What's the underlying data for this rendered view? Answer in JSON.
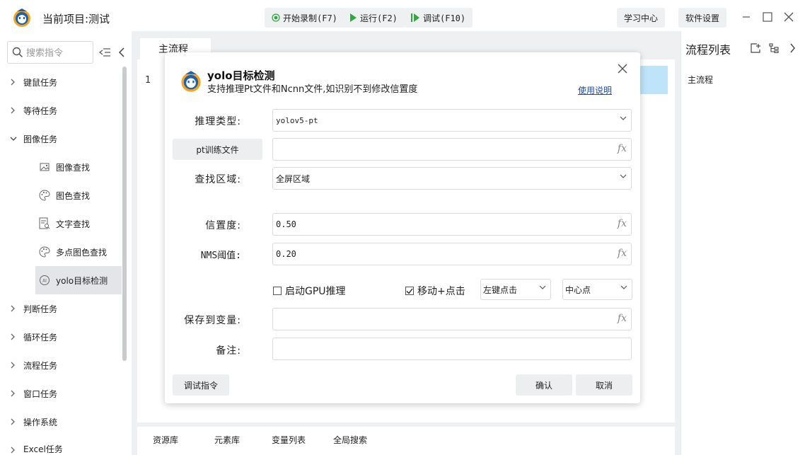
{
  "titlebar": {
    "project_title": "当前项目:测试",
    "record_label": "开始录制(F7)",
    "run_label": "运行(F2)",
    "debug_label": "调试(F10)",
    "learn_label": "学习中心",
    "settings_label": "软件设置",
    "colors": {
      "run_icon": "#2eaa3c",
      "debug_icon": "#2eaa3c",
      "record_icon": "#2eaa3c"
    }
  },
  "sidebar": {
    "search_placeholder": "搜索指令",
    "categories": [
      {
        "label": "键鼠任务",
        "expanded": false
      },
      {
        "label": "等待任务",
        "expanded": false
      },
      {
        "label": "图像任务",
        "expanded": true
      },
      {
        "label": "判断任务",
        "expanded": false
      },
      {
        "label": "循环任务",
        "expanded": false
      },
      {
        "label": "流程任务",
        "expanded": false
      },
      {
        "label": "窗口任务",
        "expanded": false
      },
      {
        "label": "操作系统",
        "expanded": false
      },
      {
        "label": "Excel任务",
        "expanded": false
      }
    ],
    "image_subitems": [
      {
        "label": "图像查找",
        "icon": "image-icon"
      },
      {
        "label": "图色查找",
        "icon": "palette-icon"
      },
      {
        "label": "文字查找",
        "icon": "text-search-icon"
      },
      {
        "label": "多点图色查找",
        "icon": "palette-icon"
      },
      {
        "label": "yolo目标检测",
        "icon": "ai-icon",
        "active": true
      }
    ]
  },
  "main": {
    "tab_label": "主流程",
    "line_number": "1",
    "bottom_tabs": [
      "资源库",
      "元素库",
      "变量列表",
      "全局搜索"
    ]
  },
  "right_panel": {
    "title": "流程列表",
    "items": [
      "主流程"
    ]
  },
  "dialog": {
    "title": "yolo目标检测",
    "subtitle": "支持推理Pt文件和Ncnn文件,如识别不到修改信置度",
    "help_link": "使用说明",
    "infer_type_label": "推理类型:",
    "infer_type_value": "yolov5-pt",
    "pt_button_label": "pt训练文件",
    "pt_file_value": "",
    "region_label": "查找区域:",
    "region_value": "全屏区域",
    "confidence_label": "信置度:",
    "confidence_value": "0.50",
    "nms_label": "NMS阈值:",
    "nms_value": "0.20",
    "gpu_label": "启动GPU推理",
    "gpu_checked": false,
    "move_click_label": "移动+点击",
    "move_click_checked": true,
    "click_type_value": "左键点击",
    "click_pos_value": "中心点",
    "save_var_label": "保存到变量:",
    "save_var_value": "",
    "note_label": "备注:",
    "note_value": "",
    "debug_button": "调试指令",
    "confirm_button": "确认",
    "cancel_button": "取消",
    "fx_label": "fx"
  }
}
